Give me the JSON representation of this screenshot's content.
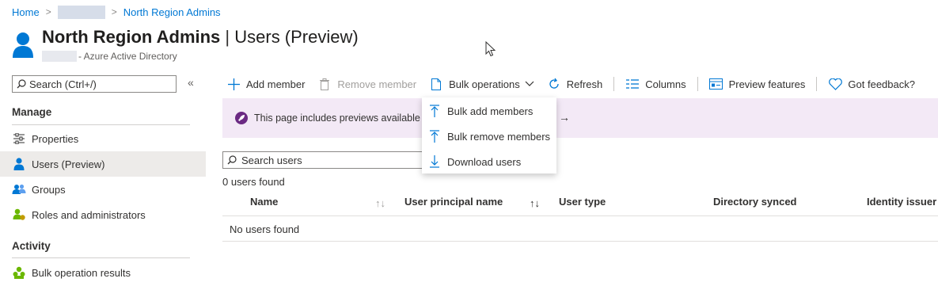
{
  "breadcrumb": {
    "home": "Home",
    "current": "North Region Admins"
  },
  "header": {
    "title": "North Region Admins",
    "title_separator": " | ",
    "title_suffix": "Users (Preview)",
    "subtitle": "- Azure Active Directory"
  },
  "sidebar": {
    "search_placeholder": "Search (Ctrl+/)",
    "collapse_glyph": "«",
    "sections": [
      {
        "heading": "Manage"
      },
      {
        "heading": "Activity"
      }
    ],
    "items": [
      {
        "label": "Properties",
        "icon": "properties-icon"
      },
      {
        "label": "Users (Preview)",
        "icon": "user-icon",
        "active": true
      },
      {
        "label": "Groups",
        "icon": "groups-icon"
      },
      {
        "label": "Roles and administrators",
        "icon": "roles-icon"
      },
      {
        "label": "Bulk operation results",
        "icon": "bulk-results-icon"
      }
    ]
  },
  "toolbar": {
    "add_member": "Add member",
    "remove_member": "Remove member",
    "bulk_operations": "Bulk operations",
    "refresh": "Refresh",
    "columns": "Columns",
    "preview_features": "Preview features",
    "feedback": "Got feedback?"
  },
  "banner": {
    "text": "This page includes previews available fo",
    "arrow": "→"
  },
  "dropdown": {
    "items": [
      {
        "label": "Bulk add members",
        "icon": "upload-icon"
      },
      {
        "label": "Bulk remove members",
        "icon": "upload-icon"
      },
      {
        "label": "Download users",
        "icon": "download-icon"
      }
    ]
  },
  "users": {
    "search_placeholder": "Search users",
    "count_text": "0 users found",
    "columns": [
      "Name",
      "User principal name",
      "User type",
      "Directory synced",
      "Identity issuer"
    ],
    "empty_text": "No users found"
  },
  "colors": {
    "accent": "#0078d4",
    "banner_bg": "#f3e9f6",
    "active_nav": "#edebe9",
    "rocket": "#6b2a83"
  }
}
